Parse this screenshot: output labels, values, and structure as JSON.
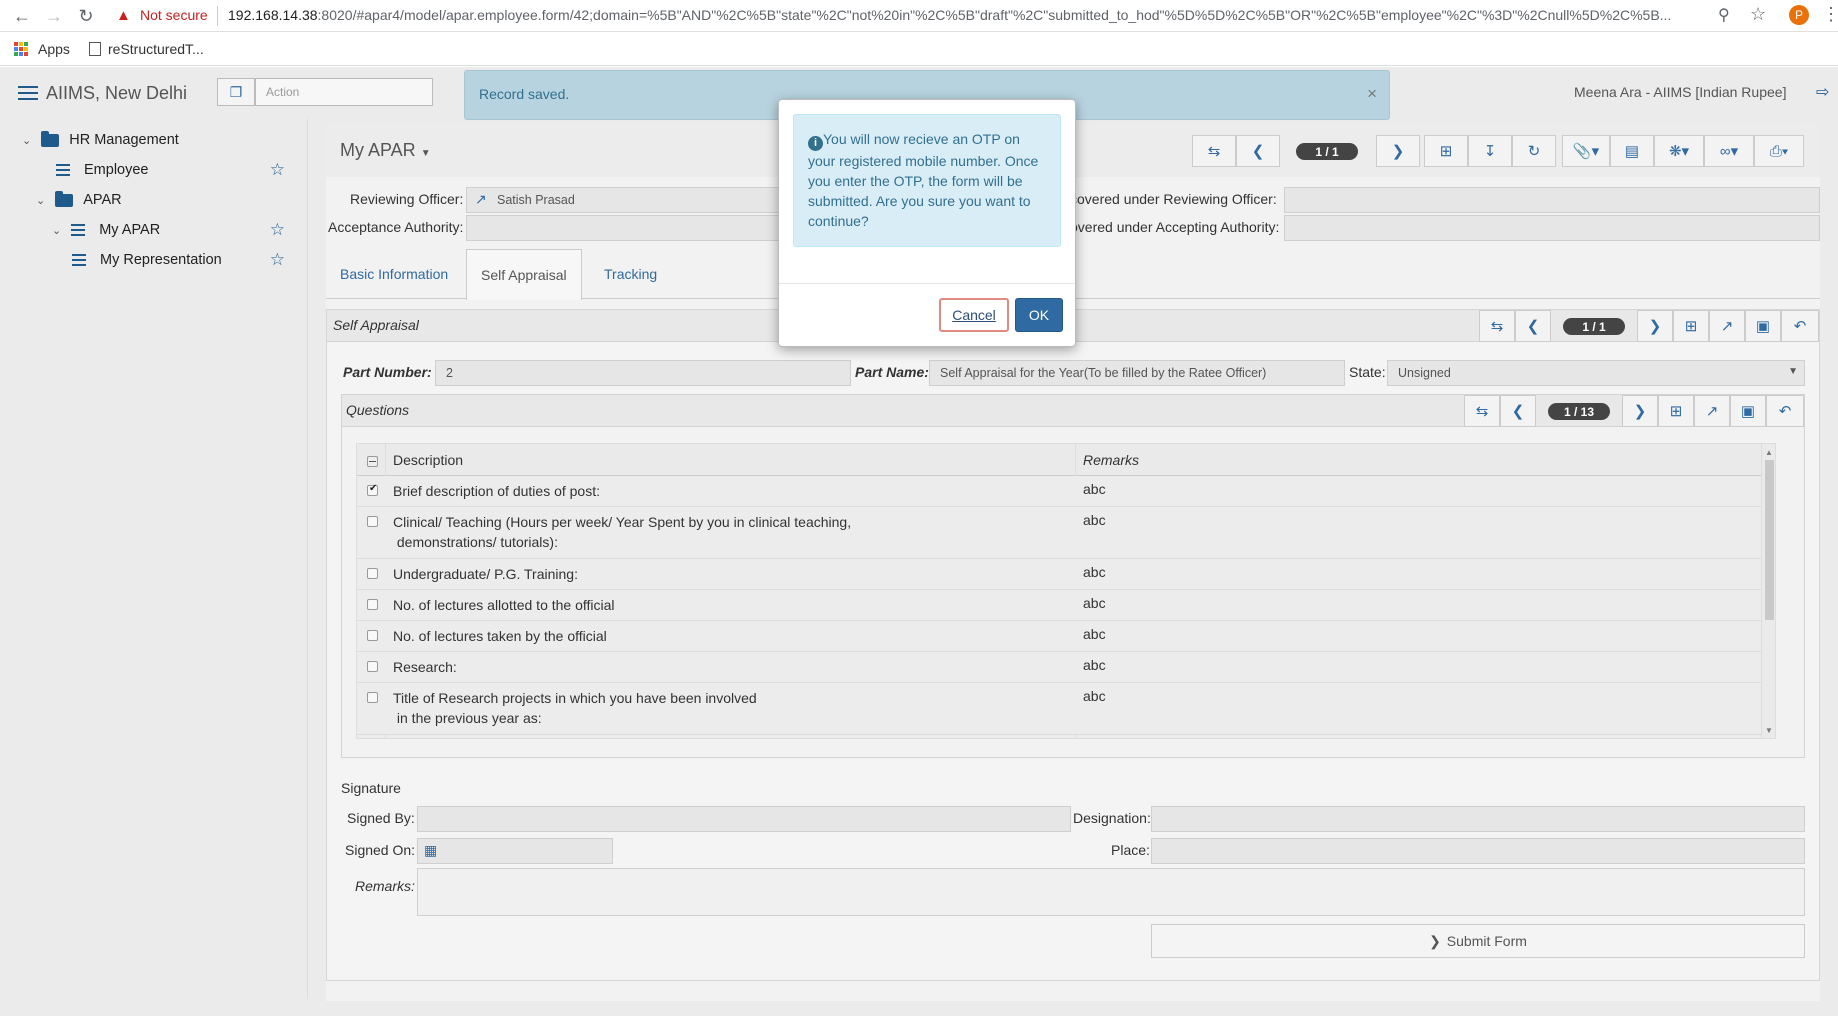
{
  "browser": {
    "security_label": "Not secure",
    "url_host": "192.168.14.38",
    "url_rest": ":8020/#apar4/model/apar.employee.form/42;domain=%5B\"AND\"%2C%5B\"state\"%2C\"not%20in\"%2C%5B\"draft\"%2C\"submitted_to_hod\"%5D%5D%2C%5B\"OR\"%2C%5B\"employee\"%2C\"%3D\"%2Cnull%5D%2C%5B...",
    "profile_initial": "P",
    "bookmarks": {
      "apps": "Apps",
      "item": "reStructuredT..."
    }
  },
  "header": {
    "app_title": "AIIMS, New Delhi",
    "action_placeholder": "Action",
    "notification": "Record saved.",
    "user": "Meena Ara - AIIMS [Indian Rupee]"
  },
  "sidebar": {
    "hr": "HR Management",
    "employee": "Employee",
    "apar": "APAR",
    "my_apar": "My APAR",
    "my_representation": "My Representation"
  },
  "form": {
    "title": "My APAR",
    "record_pager": "1 / 1",
    "reviewing_officer_label": "Reviewing Officer:",
    "reviewing_officer_value": "Satish Prasad",
    "acceptance_authority_label": "Acceptance Authority:",
    "covered_reviewing_label": "covered under Reviewing Officer:",
    "covered_accepting_label": "overed under Accepting Authority:",
    "tabs": [
      "Basic Information",
      "Self Appraisal",
      "Tracking"
    ]
  },
  "self_appraisal": {
    "section_title": "Self Appraisal",
    "pager": "1 / 1",
    "part_number_label": "Part Number:",
    "part_number": "2",
    "part_name_label": "Part Name:",
    "part_name": "Self Appraisal for the Year(To be filled by the Ratee Officer)",
    "state_label": "State:",
    "state": "Unsigned"
  },
  "questions": {
    "title": "Questions",
    "pager": "1 / 13",
    "col_description": "Description",
    "col_remarks": "Remarks",
    "rows": [
      {
        "d1": "Brief description of duties of post:",
        "d2": "",
        "remarks": "abc",
        "checked": true
      },
      {
        "d1": "Clinical/ Teaching (Hours per week/ Year Spent by you in clinical teaching,",
        "d2": " demonstrations/ tutorials):",
        "remarks": "abc",
        "checked": false
      },
      {
        "d1": "Undergraduate/ P.G. Training:",
        "d2": "",
        "remarks": "abc",
        "checked": false
      },
      {
        "d1": "No. of lectures allotted to the official",
        "d2": "",
        "remarks": "abc",
        "checked": false
      },
      {
        "d1": "No. of lectures taken by the official",
        "d2": "",
        "remarks": "abc",
        "checked": false
      },
      {
        "d1": "Research:",
        "d2": "",
        "remarks": "abc",
        "checked": false
      },
      {
        "d1": "Title of Research projects in which you have been involved",
        "d2": " in the previous year as:",
        "remarks": "abc",
        "checked": false
      }
    ]
  },
  "signature": {
    "title": "Signature",
    "signed_by_label": "Signed By:",
    "designation_label": "Designation:",
    "signed_on_label": "Signed On:",
    "place_label": "Place:",
    "remarks_label": "Remarks:",
    "submit_label": "Submit Form"
  },
  "modal": {
    "message": "You will now recieve an OTP on your registered mobile number. Once you enter the OTP, the form will be submitted. Are you sure you want to continue?",
    "cancel": "Cancel",
    "ok": "OK"
  },
  "colors": {
    "accent": "#2f6aa2",
    "info_bg": "#d9edf7",
    "info_text": "#31708f",
    "notice_bg": "#b8d3e0"
  }
}
